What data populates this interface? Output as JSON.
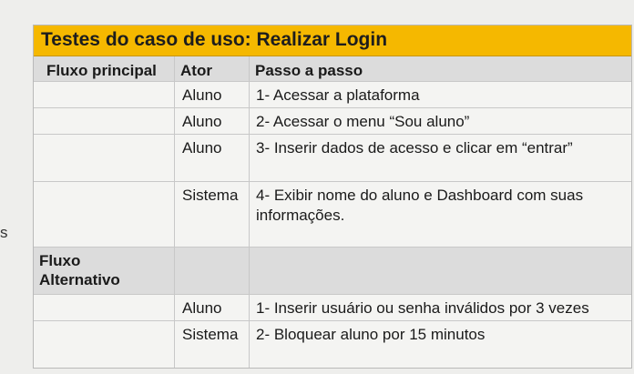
{
  "side_fragment": "s",
  "table": {
    "title": "Testes do caso de uso: Realizar Login",
    "headers": {
      "col1": "Fluxo principal",
      "col2": "Ator",
      "col3": "Passo a passo"
    },
    "main_flow": [
      {
        "ator": "Aluno",
        "passo": "1- Acessar a plataforma"
      },
      {
        "ator": "Aluno",
        "passo": "2- Acessar o menu “Sou aluno”"
      },
      {
        "ator": "Aluno",
        "passo": "3- Inserir dados de acesso e clicar em “entrar”"
      },
      {
        "ator": "Sistema",
        "passo": "4- Exibir nome do aluno e Dashboard com suas informações."
      }
    ],
    "alt_header": {
      "col1_line1": "Fluxo",
      "col1_line2": "Alternativo"
    },
    "alt_flow": [
      {
        "ator": "Aluno",
        "passo": "1-  Inserir usuário ou senha inválidos por 3 vezes"
      },
      {
        "ator": "Sistema",
        "passo": "2- Bloquear aluno por 15 minutos"
      }
    ]
  },
  "colors": {
    "title_background": "#f5b800",
    "header_background": "#dcdcdc",
    "border": "#c8c8c8"
  }
}
